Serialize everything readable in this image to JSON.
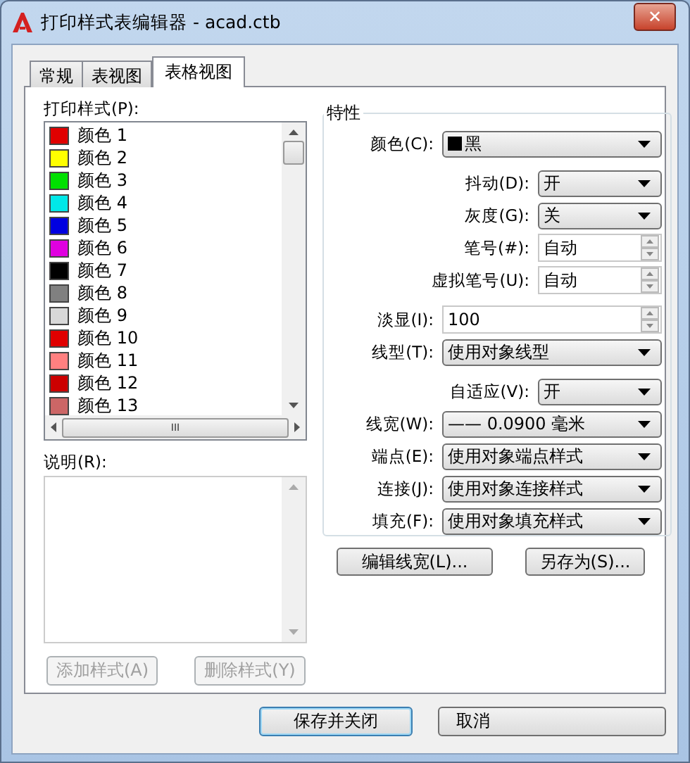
{
  "window": {
    "title": "打印样式表编辑器 - acad.ctb",
    "close": "✕"
  },
  "tabs": [
    {
      "label": "常规",
      "selected": false
    },
    {
      "label": "表视图",
      "selected": false
    },
    {
      "label": "表格视图",
      "selected": true
    }
  ],
  "styles_list": {
    "label": "打印样式(P):",
    "items": [
      {
        "name": "颜色",
        "number": "1",
        "color": "#e00000"
      },
      {
        "name": "颜色",
        "number": "2",
        "color": "#ffff00"
      },
      {
        "name": "颜色",
        "number": "3",
        "color": "#00e000"
      },
      {
        "name": "颜色",
        "number": "4",
        "color": "#00e8e8"
      },
      {
        "name": "颜色",
        "number": "5",
        "color": "#0000e0"
      },
      {
        "name": "颜色",
        "number": "6",
        "color": "#e000e0"
      },
      {
        "name": "颜色",
        "number": "7",
        "color": "#000000"
      },
      {
        "name": "颜色",
        "number": "8",
        "color": "#808080"
      },
      {
        "name": "颜色",
        "number": "9",
        "color": "#d8d8d8"
      },
      {
        "name": "颜色",
        "number": "10",
        "color": "#e00000"
      },
      {
        "name": "颜色",
        "number": "11",
        "color": "#ff8080"
      },
      {
        "name": "颜色",
        "number": "12",
        "color": "#cc0000"
      },
      {
        "name": "颜色",
        "number": "13",
        "color": "#cc6666"
      }
    ],
    "hscroll_grip": "III"
  },
  "description": {
    "label": "说明(R):"
  },
  "style_buttons": [
    {
      "label": "添加样式(A)",
      "disabled": true
    },
    {
      "label": "删除样式(Y)",
      "disabled": true
    }
  ],
  "properties": {
    "title": "特性",
    "rows": [
      {
        "label": "颜色(C):",
        "kind": "select",
        "value": "黑",
        "color": "#000000"
      },
      {
        "label": "抖动(D):",
        "kind": "select",
        "value": "开"
      },
      {
        "label": "灰度(G):",
        "kind": "select",
        "value": "关"
      },
      {
        "label": "笔号(#):",
        "kind": "spinner",
        "value": "自动"
      },
      {
        "label": "虚拟笔号(U):",
        "kind": "spinner",
        "value": "自动"
      },
      {
        "label": "淡显(I):",
        "kind": "spinner",
        "value": "100"
      },
      {
        "label": "线型(T):",
        "kind": "select",
        "value": "使用对象线型"
      },
      {
        "label": "自适应(V):",
        "kind": "select",
        "value": "开"
      },
      {
        "label": "线宽(W):",
        "kind": "select",
        "value": "—— 0.0900 毫米"
      },
      {
        "label": "端点(E):",
        "kind": "select",
        "value": "使用对象端点样式"
      },
      {
        "label": "连接(J):",
        "kind": "select",
        "value": "使用对象连接样式"
      },
      {
        "label": "填充(F):",
        "kind": "select",
        "value": "使用对象填充样式"
      }
    ]
  },
  "property_buttons": [
    {
      "label": "编辑线宽(L)..."
    },
    {
      "label": "另存为(S)..."
    }
  ],
  "footer_buttons": [
    {
      "label": "保存并关闭",
      "default": true
    },
    {
      "label": "取消",
      "default": false
    }
  ]
}
